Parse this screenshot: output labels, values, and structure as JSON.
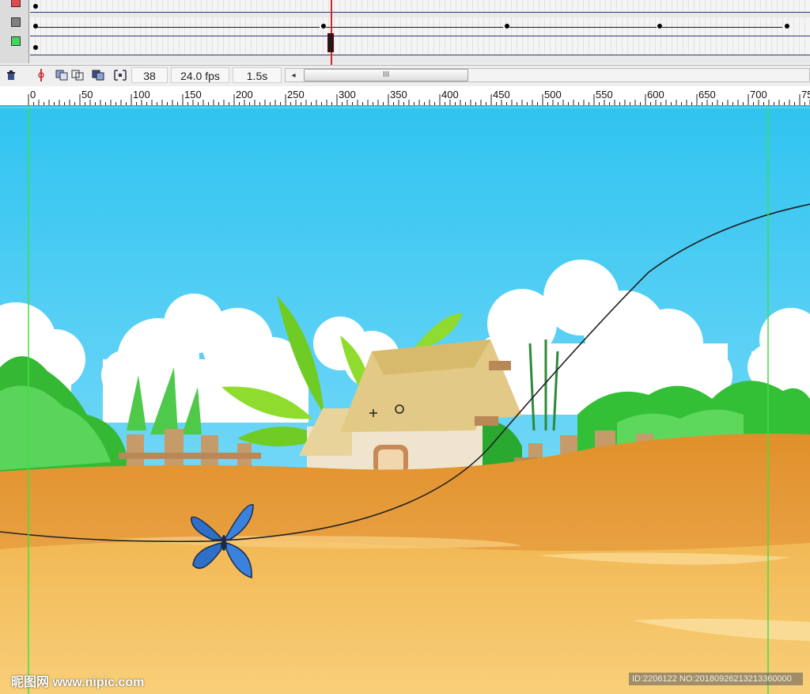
{
  "timeline": {
    "current_frame": "38",
    "frame_rate": "24.0 fps",
    "elapsed_time": "1.5s",
    "scroll_thumb_label": "III",
    "scroll_left_arrow": "◂"
  },
  "ruler": {
    "labels": [
      "0",
      "50",
      "100",
      "150",
      "200",
      "250",
      "300",
      "350",
      "400",
      "450",
      "500",
      "550",
      "600",
      "650",
      "700",
      "75"
    ]
  },
  "watermark": {
    "site": "昵图网 www.nipic.com",
    "id_text": "ID:2206122 NO:20180926213213360000"
  },
  "colors": {
    "sky_top": "#2fc4f0",
    "sky_bottom": "#9fe6ff",
    "sand_dark": "#e0902a",
    "sand_light": "#f4c36a",
    "foliage": "#3ec63e",
    "butterfly": "#2e6fc8",
    "guide_line": "#3fe03f"
  },
  "icons": {
    "trash": "trash-icon",
    "add_motion_guide": "motion-guide-icon",
    "onion_skin": "onion-skin-icon",
    "onion_outline": "onion-outline-icon",
    "edit_multiple": "edit-multiple-frames-icon",
    "onion_markers": "onion-markers-icon"
  }
}
